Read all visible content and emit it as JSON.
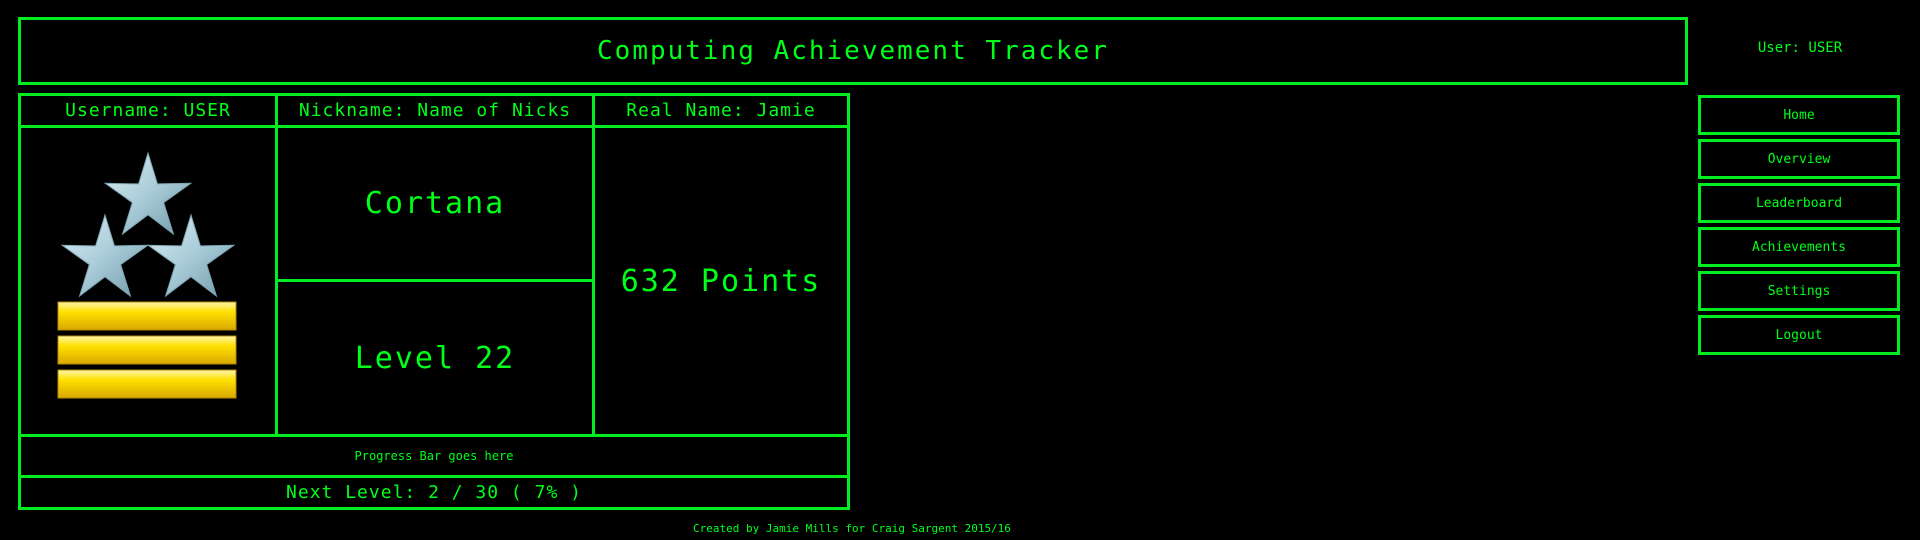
{
  "header": {
    "title": "Computing Achievement Tracker",
    "user_label": "User: USER"
  },
  "nav": {
    "items": [
      {
        "label": "Home"
      },
      {
        "label": "Overview"
      },
      {
        "label": "Leaderboard"
      },
      {
        "label": "Achievements"
      },
      {
        "label": "Settings"
      },
      {
        "label": "Logout"
      }
    ]
  },
  "profile": {
    "username": "Username: USER",
    "nickname": "Nickname: Name of Nicks",
    "real_name": "Real Name: Jamie",
    "title": "Cortana",
    "level": "Level 22",
    "points": "632 Points",
    "progress_placeholder": "Progress Bar goes here",
    "next_level": "Next Level: 2 / 30 ( 7% )",
    "rank_icon": "rank-insignia-three-stars-three-bars"
  },
  "footer": {
    "credit": "Created by Jamie Mills for Craig Sargent 2015/16"
  },
  "colors": {
    "background": "#000000",
    "accent": "#00ff19",
    "border": "#00ee22",
    "star": "#a9ccd8",
    "bar": "#ffd000"
  }
}
